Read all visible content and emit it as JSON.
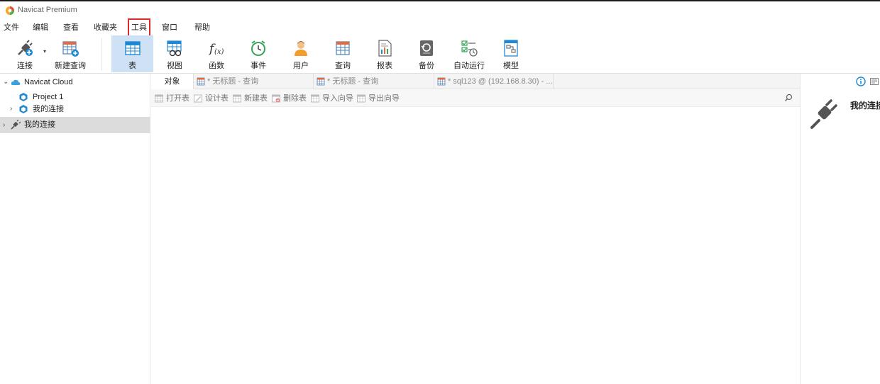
{
  "window": {
    "title": "Navicat Premium"
  },
  "menu": {
    "items": [
      "文件",
      "编辑",
      "查看",
      "收藏夹",
      "工具",
      "窗口",
      "帮助"
    ],
    "highlighted_index": 4
  },
  "toolbar": {
    "connect": "连接",
    "new_query": "新建查询",
    "table": "表",
    "view": "视图",
    "function": "函数",
    "event": "事件",
    "user": "用户",
    "query": "查询",
    "report": "报表",
    "backup": "备份",
    "automation": "自动运行",
    "model": "模型",
    "active": "表"
  },
  "sidebar": {
    "cloud": "Navicat Cloud",
    "project": "Project 1",
    "cloud_connections": "我的连接",
    "local_connections": "我的连接"
  },
  "tabs": {
    "objects": "对象",
    "query1": "* 无标题 - 查询",
    "query2": "* 无标题 - 查询",
    "query3": "* sql123 @ (192.168.8.30) - ..."
  },
  "object_toolbar": {
    "open_table": "打开表",
    "design_table": "设计表",
    "new_table": "新建表",
    "delete_table": "删除表",
    "import_wizard": "导入向导",
    "export_wizard": "导出向导"
  },
  "info_panel": {
    "name": "我的连接"
  },
  "colors": {
    "accent": "#1e88d2",
    "highlight_red": "#e0292f",
    "active_toolbar": "#cfe1f5"
  }
}
